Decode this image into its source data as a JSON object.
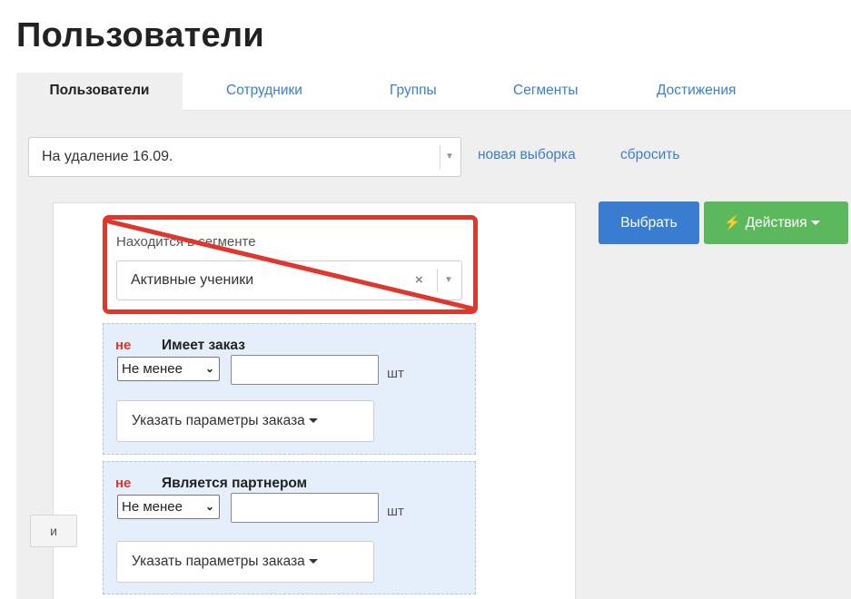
{
  "page": {
    "title": "Пользователи"
  },
  "tabs": [
    {
      "label": "Пользователи",
      "active": true
    },
    {
      "label": "Сотрудники",
      "active": false
    },
    {
      "label": "Группы",
      "active": false
    },
    {
      "label": "Сегменты",
      "active": false
    },
    {
      "label": "Достижения",
      "active": false
    }
  ],
  "selection": {
    "value": "На удаление 16.09.",
    "new_link": "новая выборка",
    "reset_link": "сбросить"
  },
  "filter": {
    "join_label": "и",
    "segment_condition": {
      "label": "Находится в сегменте",
      "value": "Активные ученики",
      "clear_icon": "×"
    },
    "conditions": [
      {
        "negation": "не",
        "title": "Имеет заказ",
        "comparator": "Не менее",
        "quantity": "",
        "unit": "шт",
        "params_label": "Указать параметры заказа"
      },
      {
        "negation": "не",
        "title": "Является партнером",
        "comparator": "Не менее",
        "quantity": "",
        "unit": "шт",
        "params_label": "Указать параметры заказа"
      }
    ]
  },
  "actions": {
    "select_label": "Выбрать",
    "actions_label": "Действия",
    "actions_icon": "bolt-icon"
  },
  "colors": {
    "link": "#3b7fcf",
    "primary": "#3a7ccf",
    "success": "#5cb85c",
    "annotation": "#e0362c",
    "condition_bg": "#e4effb"
  }
}
